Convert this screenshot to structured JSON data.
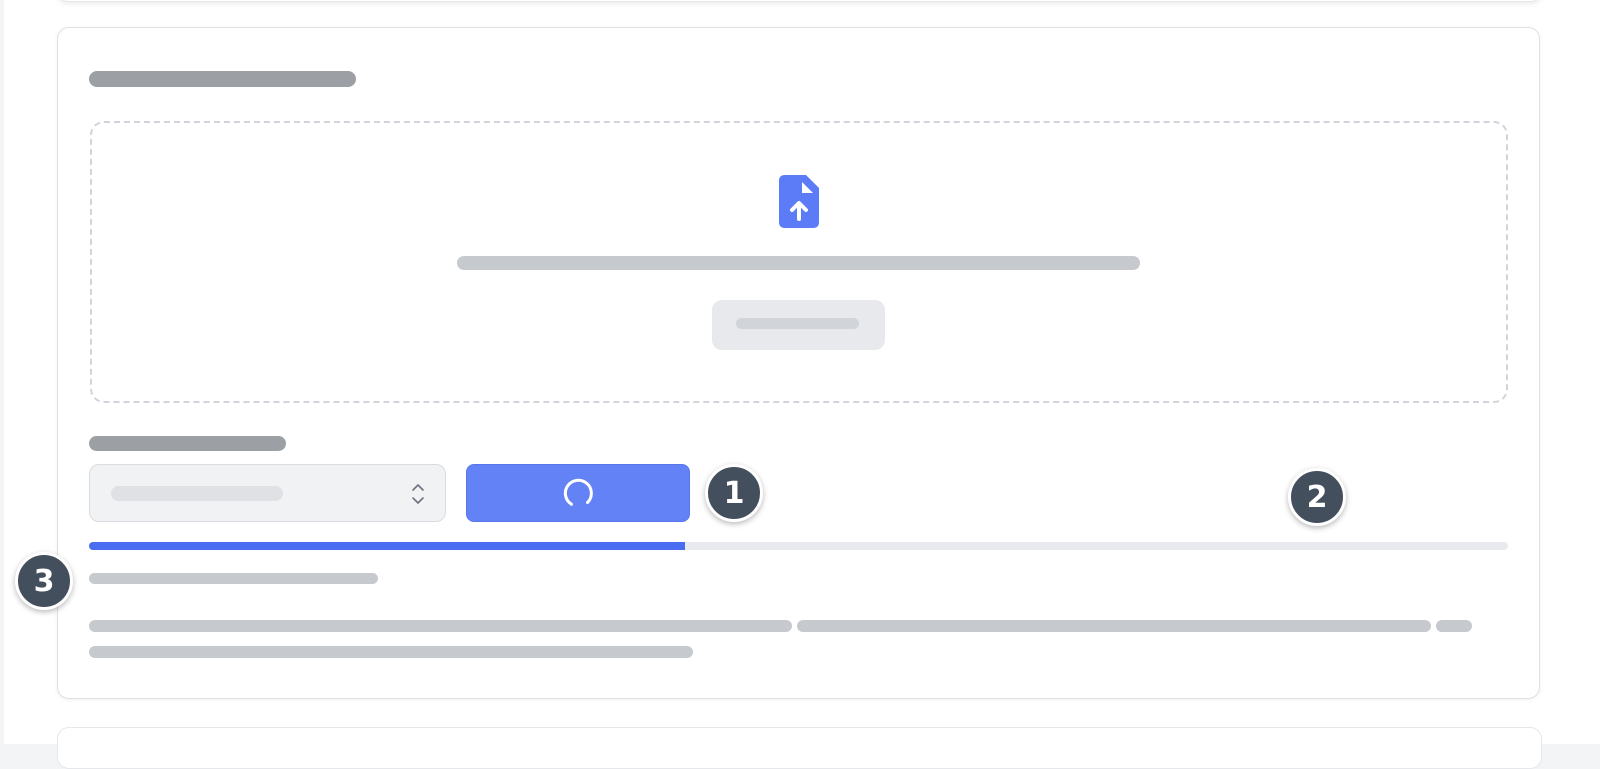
{
  "upload": {
    "progress_percent": 42,
    "accent_color": "#4a6cf0",
    "dropzone_icon": "file-upload-icon",
    "submit_icon": "loading-spinner-icon",
    "select_icon": "chevron-up-down-icon"
  },
  "markers": [
    {
      "label": "1"
    },
    {
      "label": "2"
    },
    {
      "label": "3"
    }
  ]
}
